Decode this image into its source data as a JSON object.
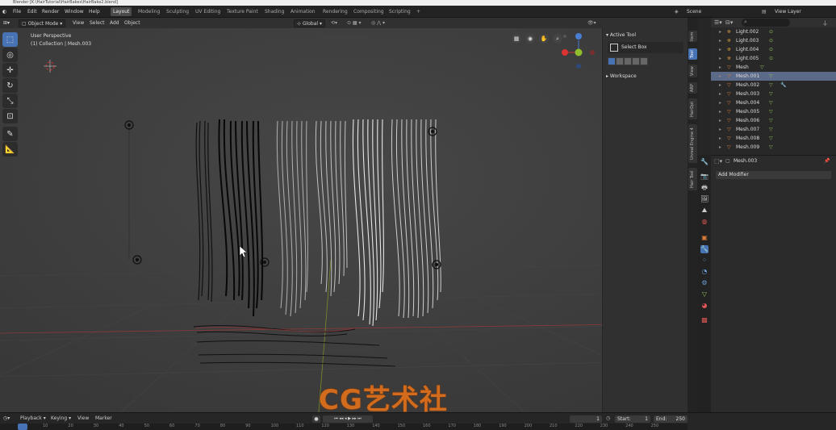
{
  "titlebar": {
    "title": "Blender [K:\\HairTutorial\\HairBakes\\HairBake2.blend]"
  },
  "topmenu": {
    "items": [
      "File",
      "Edit",
      "Render",
      "Window",
      "Help"
    ],
    "workspaces": [
      "Layout",
      "Modeling",
      "Sculpting",
      "UV Editing",
      "Texture Paint",
      "Shading",
      "Animation",
      "Rendering",
      "Compositing",
      "Scripting"
    ],
    "plus": "+",
    "scene": "Scene",
    "view_layer": "View Layer"
  },
  "viewport": {
    "mode": "Object Mode",
    "menus": [
      "View",
      "Select",
      "Add",
      "Object"
    ],
    "orientation": "Global",
    "perspective": "User Perspective",
    "collection": "(1) Collection | Mesh.003"
  },
  "npanel": {
    "active_tool": "Active Tool",
    "select_box": "Select Box",
    "workspace": "Workspace",
    "tabs": [
      "Item",
      "Tool",
      "View",
      "ARP",
      "HairDpt",
      "Unreal Engine 4",
      "Hair Tool"
    ]
  },
  "outliner": {
    "rows": [
      {
        "name": "Light.002"
      },
      {
        "name": "Light.003"
      },
      {
        "name": "Light.004"
      },
      {
        "name": "Light.005"
      },
      {
        "name": "Mesh"
      },
      {
        "name": "Mesh.001"
      },
      {
        "name": "Mesh.002"
      },
      {
        "name": "Mesh.003"
      },
      {
        "name": "Mesh.004"
      },
      {
        "name": "Mesh.005"
      },
      {
        "name": "Mesh.006"
      },
      {
        "name": "Mesh.007"
      },
      {
        "name": "Mesh.008"
      },
      {
        "name": "Mesh.009"
      }
    ]
  },
  "properties": {
    "object": "Mesh.003",
    "add_modifier": "Add Modifier"
  },
  "timeline": {
    "menus": [
      "Playback",
      "Keying",
      "View",
      "Marker"
    ],
    "current_frame": "1",
    "start_label": "Start",
    "start": "1",
    "end_label": "End",
    "end": "250",
    "ticks": [
      "10",
      "20",
      "30",
      "40",
      "50",
      "60",
      "70",
      "80",
      "90",
      "100",
      "110",
      "120",
      "130",
      "140",
      "150",
      "160",
      "170",
      "180",
      "190",
      "200",
      "210",
      "220",
      "230",
      "240",
      "250"
    ]
  },
  "watermark": {
    "text": "CG艺术社"
  }
}
